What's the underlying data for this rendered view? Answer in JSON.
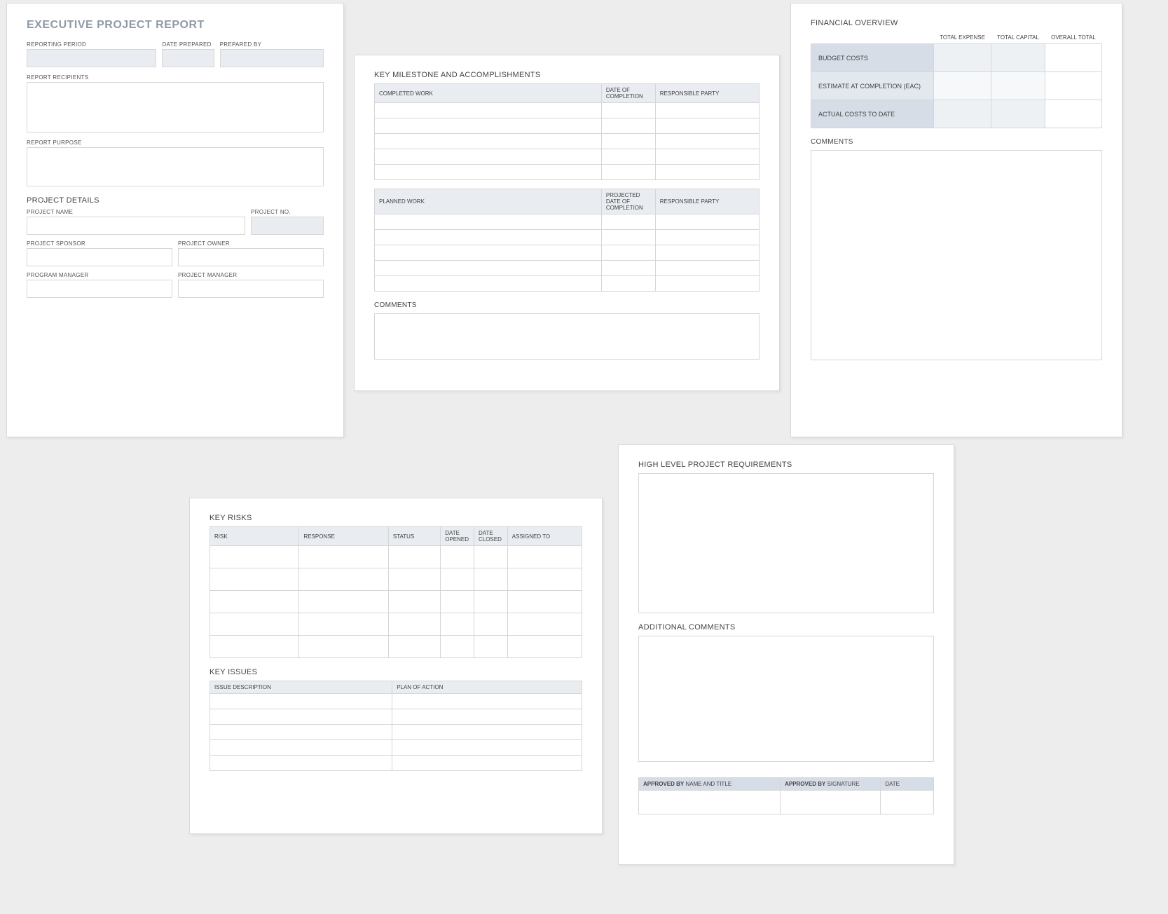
{
  "panel1": {
    "title": "EXECUTIVE PROJECT REPORT",
    "reporting_period": "REPORTING PERIOD",
    "date_prepared": "DATE PREPARED",
    "prepared_by": "PREPARED BY",
    "report_recipients": "REPORT RECIPIENTS",
    "report_purpose": "REPORT PURPOSE",
    "project_details": "PROJECT DETAILS",
    "project_name": "PROJECT NAME",
    "project_no": "PROJECT NO.",
    "project_sponsor": "PROJECT SPONSOR",
    "project_owner": "PROJECT OWNER",
    "program_manager": "PROGRAM MANAGER",
    "project_manager": "PROJECT MANAGER"
  },
  "panel2": {
    "title": "KEY MILESTONE AND ACCOMPLISHMENTS",
    "completed_work": "COMPLETED WORK",
    "date_of_completion": "DATE OF COMPLETION",
    "responsible_party": "RESPONSIBLE PARTY",
    "planned_work": "PLANNED WORK",
    "projected_date": "PROJECTED DATE OF COMPLETION",
    "comments": "COMMENTS"
  },
  "panel3": {
    "title": "FINANCIAL OVERVIEW",
    "total_expense": "TOTAL EXPENSE",
    "total_capital": "TOTAL CAPITAL",
    "overall_total": "OVERALL TOTAL",
    "budget_costs": "BUDGET COSTS",
    "eac": "ESTIMATE AT COMPLETION (EAC)",
    "actual": "ACTUAL COSTS TO DATE",
    "comments": "COMMENTS"
  },
  "panel4": {
    "key_risks": "KEY RISKS",
    "risk": "RISK",
    "response": "RESPONSE",
    "status": "STATUS",
    "date_opened": "DATE OPENED",
    "date_closed": "DATE CLOSED",
    "assigned_to": "ASSIGNED TO",
    "key_issues": "KEY ISSUES",
    "issue_description": "ISSUE DESCRIPTION",
    "plan_of_action": "PLAN OF ACTION"
  },
  "panel5": {
    "title": "HIGH LEVEL PROJECT REQUIREMENTS",
    "additional_comments": "ADDITIONAL COMMENTS",
    "approved_by_bold": "APPROVED BY",
    "name_title": " NAME AND TITLE",
    "signature": " SIGNATURE",
    "date": "DATE"
  }
}
